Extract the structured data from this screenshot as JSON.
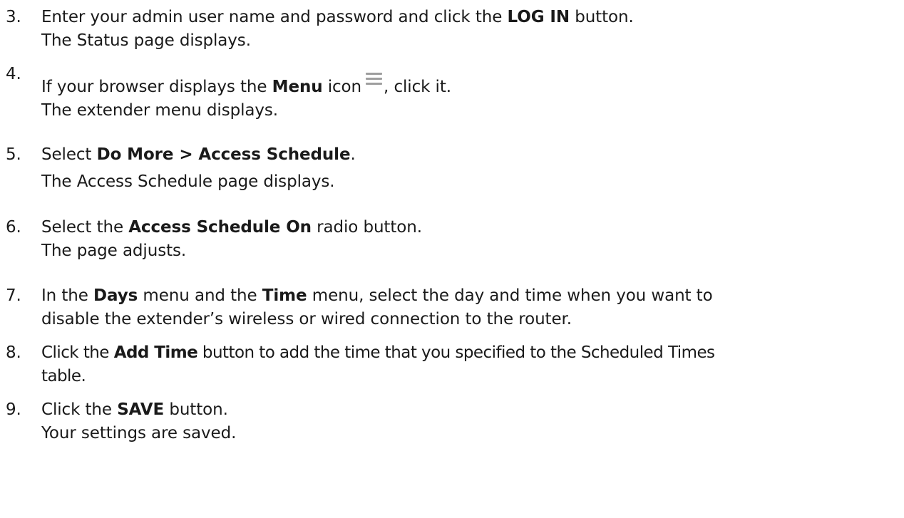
{
  "steps": [
    {
      "number": "3.",
      "line1_pre": "Enter your admin user name and password and click the ",
      "line1_bold": "LOG IN",
      "line1_post": " button.",
      "result": "The Status page displays."
    },
    {
      "number": "4.",
      "line1_pre": "If your browser displays the ",
      "line1_bold": "Menu",
      "line1_mid": " icon",
      "line1_post": ", click it.",
      "icon": "hamburger-menu-icon",
      "result": "The extender menu displays."
    },
    {
      "number": "5.",
      "line1_pre": "Select ",
      "line1_bold": "Do More > Access Schedule",
      "line1_post": ".",
      "result": "The Access Schedule page displays."
    },
    {
      "number": "6.",
      "line1_pre": "Select the ",
      "line1_bold": "Access Schedule On",
      "line1_post": " radio button.",
      "result": "The page adjusts."
    },
    {
      "number": "7.",
      "line1_pre": "In the ",
      "line1_bold": "Days",
      "line1_mid": " menu and the ",
      "line1_bold2": "Time",
      "line1_post": " menu, select the day and time when you want to",
      "line2": "disable the extender’s wireless or wired connection to the router."
    },
    {
      "number": "8.",
      "line1_pre": "Click the ",
      "line1_bold": "Add Time",
      "line1_post": " button to add the time that you specified to the Scheduled Times",
      "line2": "table."
    },
    {
      "number": "9.",
      "line1_pre": "Click the ",
      "line1_bold": "SAVE",
      "line1_post": " button.",
      "result": "Your settings are saved."
    }
  ]
}
